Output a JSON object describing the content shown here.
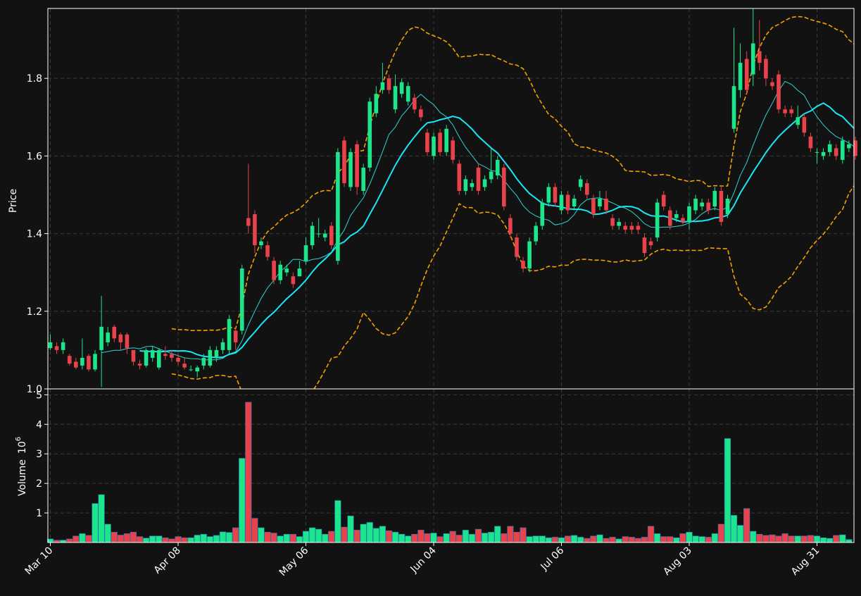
{
  "chart_data": {
    "type": "candlestick",
    "colors": {
      "background": "#121212",
      "up": "#1be68c",
      "down": "#e8424a",
      "ma_fast": "#2fd2d2",
      "ma_slow": "#19e6f5",
      "bollinger": "#f5a000",
      "grid": "#3a3a3a",
      "text": "#ffffff",
      "frame": "#ffffff"
    },
    "price_panel": {
      "ylabel": "Price",
      "ylim": [
        1.0,
        1.98
      ],
      "yticks": [
        "1.0",
        "1.2",
        "1.4",
        "1.6",
        "1.8"
      ],
      "ytick_values": [
        1.0,
        1.2,
        1.4,
        1.6,
        1.8
      ]
    },
    "volume_panel": {
      "ylabel": "Volume",
      "exponent_label": "10",
      "exponent_power": "6",
      "ylim": [
        0,
        5.2
      ],
      "yticks": [
        "1",
        "2",
        "3",
        "4",
        "5"
      ],
      "ytick_values": [
        1,
        2,
        3,
        4,
        5
      ]
    },
    "x_axis": {
      "tick_labels": [
        "Mar 10",
        "Apr 08",
        "May 06",
        "Jun 04",
        "Jul 06",
        "Aug 03",
        "Aug 31"
      ],
      "tick_index": [
        0,
        20,
        40,
        60,
        80,
        100,
        120
      ]
    },
    "series": [
      {
        "name": "OHLC",
        "x_start": "Mar 10"
      },
      {
        "name": "MA fast"
      },
      {
        "name": "MA slow"
      },
      {
        "name": "Bollinger upper"
      },
      {
        "name": "Bollinger lower"
      }
    ],
    "ohlc": [
      [
        1.105,
        1.12,
        1.14,
        1.1
      ],
      [
        1.11,
        1.1,
        1.12,
        1.09
      ],
      [
        1.1,
        1.12,
        1.13,
        1.09
      ],
      [
        1.085,
        1.065,
        1.09,
        1.06
      ],
      [
        1.07,
        1.055,
        1.08,
        1.05
      ],
      [
        1.06,
        1.08,
        1.13,
        1.05
      ],
      [
        1.085,
        1.05,
        1.09,
        1.045
      ],
      [
        1.05,
        1.09,
        1.1,
        1.045
      ],
      [
        1.1,
        1.16,
        1.24,
        1.005
      ],
      [
        1.12,
        1.145,
        1.16,
        1.11
      ],
      [
        1.16,
        1.13,
        1.165,
        1.12
      ],
      [
        1.14,
        1.12,
        1.145,
        1.1
      ],
      [
        1.14,
        1.105,
        1.145,
        1.09
      ],
      [
        1.1,
        1.07,
        1.1,
        1.06
      ],
      [
        1.065,
        1.06,
        1.075,
        1.05
      ],
      [
        1.06,
        1.1,
        1.105,
        1.055
      ],
      [
        1.08,
        1.1,
        1.11,
        1.07
      ],
      [
        1.055,
        1.1,
        1.105,
        1.05
      ],
      [
        1.09,
        1.085,
        1.11,
        1.075
      ],
      [
        1.09,
        1.08,
        1.1,
        1.07
      ],
      [
        1.08,
        1.07,
        1.09,
        1.06
      ],
      [
        1.065,
        1.055,
        1.08,
        1.05
      ],
      [
        1.05,
        1.05,
        1.06,
        1.045
      ],
      [
        1.045,
        1.055,
        1.06,
        1.03
      ],
      [
        1.06,
        1.08,
        1.09,
        1.05
      ],
      [
        1.06,
        1.1,
        1.11,
        1.055
      ],
      [
        1.08,
        1.1,
        1.11,
        1.07
      ],
      [
        1.1,
        1.12,
        1.13,
        1.09
      ],
      [
        1.1,
        1.18,
        1.19,
        1.09
      ],
      [
        1.15,
        1.12,
        1.16,
        1.1
      ],
      [
        1.15,
        1.31,
        1.32,
        1.14
      ],
      [
        1.44,
        1.42,
        1.58,
        1.4
      ],
      [
        1.45,
        1.37,
        1.46,
        1.35
      ],
      [
        1.37,
        1.38,
        1.39,
        1.36
      ],
      [
        1.37,
        1.34,
        1.38,
        1.33
      ],
      [
        1.33,
        1.28,
        1.34,
        1.27
      ],
      [
        1.28,
        1.32,
        1.33,
        1.27
      ],
      [
        1.3,
        1.31,
        1.32,
        1.29
      ],
      [
        1.29,
        1.27,
        1.3,
        1.26
      ],
      [
        1.29,
        1.31,
        1.33,
        1.29
      ],
      [
        1.33,
        1.37,
        1.39,
        1.32
      ],
      [
        1.37,
        1.42,
        1.43,
        1.36
      ],
      [
        1.4,
        1.4,
        1.44,
        1.39
      ],
      [
        1.39,
        1.4,
        1.41,
        1.38
      ],
      [
        1.42,
        1.37,
        1.43,
        1.36
      ],
      [
        1.33,
        1.61,
        1.62,
        1.32
      ],
      [
        1.64,
        1.53,
        1.65,
        1.52
      ],
      [
        1.52,
        1.61,
        1.62,
        1.51
      ],
      [
        1.63,
        1.52,
        1.64,
        1.5
      ],
      [
        1.51,
        1.57,
        1.58,
        1.5
      ],
      [
        1.57,
        1.74,
        1.75,
        1.56
      ],
      [
        1.71,
        1.76,
        1.78,
        1.7
      ],
      [
        1.77,
        1.79,
        1.84,
        1.76
      ],
      [
        1.8,
        1.77,
        1.81,
        1.76
      ],
      [
        1.72,
        1.78,
        1.81,
        1.71
      ],
      [
        1.76,
        1.79,
        1.8,
        1.75
      ],
      [
        1.74,
        1.78,
        1.79,
        1.73
      ],
      [
        1.75,
        1.72,
        1.76,
        1.71
      ],
      [
        1.72,
        1.7,
        1.73,
        1.69
      ],
      [
        1.66,
        1.61,
        1.67,
        1.6
      ],
      [
        1.6,
        1.65,
        1.66,
        1.59
      ],
      [
        1.66,
        1.61,
        1.67,
        1.6
      ],
      [
        1.61,
        1.67,
        1.68,
        1.6
      ],
      [
        1.64,
        1.59,
        1.65,
        1.58
      ],
      [
        1.58,
        1.51,
        1.59,
        1.5
      ],
      [
        1.51,
        1.54,
        1.55,
        1.5
      ],
      [
        1.52,
        1.53,
        1.54,
        1.51
      ],
      [
        1.57,
        1.51,
        1.58,
        1.5
      ],
      [
        1.52,
        1.54,
        1.55,
        1.51
      ],
      [
        1.54,
        1.56,
        1.62,
        1.53
      ],
      [
        1.55,
        1.59,
        1.6,
        1.54
      ],
      [
        1.57,
        1.47,
        1.58,
        1.46
      ],
      [
        1.44,
        1.4,
        1.45,
        1.39
      ],
      [
        1.39,
        1.34,
        1.4,
        1.33
      ],
      [
        1.33,
        1.31,
        1.34,
        1.3
      ],
      [
        1.31,
        1.38,
        1.39,
        1.3
      ],
      [
        1.38,
        1.42,
        1.43,
        1.37
      ],
      [
        1.42,
        1.48,
        1.49,
        1.41
      ],
      [
        1.48,
        1.52,
        1.53,
        1.47
      ],
      [
        1.52,
        1.48,
        1.53,
        1.47
      ],
      [
        1.46,
        1.5,
        1.51,
        1.45
      ],
      [
        1.5,
        1.46,
        1.51,
        1.45
      ],
      [
        1.47,
        1.49,
        1.5,
        1.46
      ],
      [
        1.52,
        1.54,
        1.55,
        1.51
      ],
      [
        1.53,
        1.5,
        1.54,
        1.49
      ],
      [
        1.49,
        1.45,
        1.5,
        1.44
      ],
      [
        1.47,
        1.49,
        1.51,
        1.46
      ],
      [
        1.49,
        1.46,
        1.51,
        1.45
      ],
      [
        1.44,
        1.42,
        1.45,
        1.41
      ],
      [
        1.42,
        1.43,
        1.44,
        1.41
      ],
      [
        1.42,
        1.41,
        1.43,
        1.4
      ],
      [
        1.42,
        1.41,
        1.43,
        1.4
      ],
      [
        1.42,
        1.41,
        1.43,
        1.4
      ],
      [
        1.39,
        1.35,
        1.4,
        1.34
      ],
      [
        1.38,
        1.37,
        1.39,
        1.36
      ],
      [
        1.39,
        1.48,
        1.49,
        1.38
      ],
      [
        1.5,
        1.47,
        1.51,
        1.46
      ],
      [
        1.46,
        1.42,
        1.47,
        1.41
      ],
      [
        1.44,
        1.45,
        1.46,
        1.43
      ],
      [
        1.44,
        1.43,
        1.45,
        1.42
      ],
      [
        1.43,
        1.47,
        1.48,
        1.41
      ],
      [
        1.46,
        1.49,
        1.5,
        1.45
      ],
      [
        1.47,
        1.48,
        1.49,
        1.46
      ],
      [
        1.48,
        1.46,
        1.49,
        1.45
      ],
      [
        1.47,
        1.51,
        1.52,
        1.46
      ],
      [
        1.51,
        1.43,
        1.52,
        1.42
      ],
      [
        1.45,
        1.49,
        1.5,
        1.44
      ],
      [
        1.67,
        1.78,
        1.93,
        1.66
      ],
      [
        1.77,
        1.84,
        1.89,
        1.75
      ],
      [
        1.85,
        1.77,
        1.87,
        1.76
      ],
      [
        1.81,
        1.89,
        1.98,
        1.78
      ],
      [
        1.87,
        1.84,
        1.95,
        1.82
      ],
      [
        1.85,
        1.8,
        1.86,
        1.78
      ],
      [
        1.79,
        1.78,
        1.8,
        1.77
      ],
      [
        1.81,
        1.72,
        1.82,
        1.71
      ],
      [
        1.72,
        1.71,
        1.73,
        1.7
      ],
      [
        1.72,
        1.71,
        1.73,
        1.7
      ],
      [
        1.68,
        1.7,
        1.73,
        1.67
      ],
      [
        1.7,
        1.66,
        1.71,
        1.65
      ],
      [
        1.65,
        1.62,
        1.66,
        1.61
      ],
      [
        1.61,
        1.61,
        1.62,
        1.58
      ],
      [
        1.6,
        1.61,
        1.62,
        1.59
      ],
      [
        1.61,
        1.63,
        1.64,
        1.6
      ],
      [
        1.62,
        1.6,
        1.63,
        1.59
      ],
      [
        1.59,
        1.64,
        1.65,
        1.58
      ],
      [
        1.62,
        1.63,
        1.64,
        1.61
      ],
      [
        1.64,
        1.6,
        1.65,
        1.59
      ]
    ],
    "volume": [
      0.12,
      0.08,
      0.08,
      0.12,
      0.22,
      0.3,
      0.24,
      1.32,
      1.62,
      0.62,
      0.35,
      0.25,
      0.3,
      0.35,
      0.2,
      0.15,
      0.22,
      0.22,
      0.16,
      0.12,
      0.2,
      0.16,
      0.16,
      0.25,
      0.28,
      0.2,
      0.24,
      0.36,
      0.34,
      0.5,
      2.85,
      4.75,
      0.82,
      0.5,
      0.35,
      0.32,
      0.22,
      0.28,
      0.28,
      0.2,
      0.38,
      0.5,
      0.45,
      0.28,
      0.38,
      1.42,
      0.52,
      0.9,
      0.42,
      0.62,
      0.68,
      0.48,
      0.55,
      0.4,
      0.35,
      0.28,
      0.22,
      0.28,
      0.42,
      0.3,
      0.32,
      0.2,
      0.3,
      0.38,
      0.25,
      0.42,
      0.28,
      0.45,
      0.32,
      0.35,
      0.55,
      0.3,
      0.55,
      0.35,
      0.5,
      0.2,
      0.22,
      0.22,
      0.16,
      0.18,
      0.16,
      0.22,
      0.24,
      0.18,
      0.14,
      0.22,
      0.26,
      0.14,
      0.18,
      0.12,
      0.2,
      0.18,
      0.14,
      0.18,
      0.55,
      0.3,
      0.2,
      0.2,
      0.16,
      0.3,
      0.35,
      0.22,
      0.2,
      0.18,
      0.3,
      0.62,
      3.52,
      0.92,
      0.58,
      1.15,
      0.38,
      0.28,
      0.24,
      0.26,
      0.22,
      0.3,
      0.22,
      0.22,
      0.22,
      0.24,
      0.22,
      0.16,
      0.14,
      0.24,
      0.26,
      0.1
    ]
  }
}
